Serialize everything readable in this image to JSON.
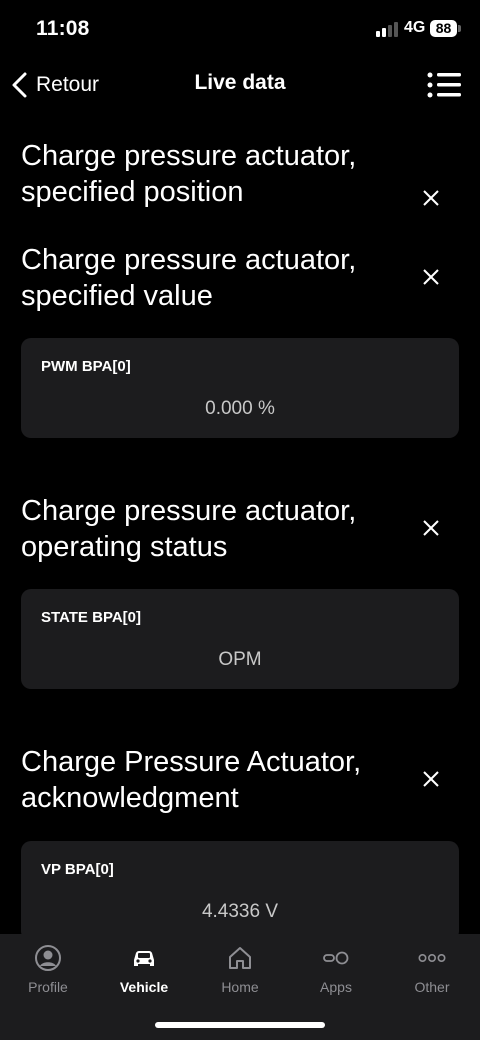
{
  "status_bar": {
    "time": "11:08",
    "network": "4G",
    "battery": "88"
  },
  "nav": {
    "back_label": "Retour",
    "title": "Live data",
    "menu_icon": "list-menu-icon"
  },
  "sections": [
    {
      "title": "Charge pressure actuator, specified position"
    },
    {
      "title": "Charge pressure actuator, specified value",
      "card": {
        "label": "PWM BPA[0]",
        "value": "0.000 %"
      }
    },
    {
      "title": "Charge pressure actuator, operating status",
      "card": {
        "label": "STATE BPA[0]",
        "value": "OPM"
      }
    },
    {
      "title": "Charge Pressure Actuator, acknowledgment",
      "card": {
        "label": "VP BPA[0]",
        "value": "4.4336 V"
      }
    }
  ],
  "tabs": [
    {
      "label": "Profile",
      "icon": "profile-icon",
      "active": false
    },
    {
      "label": "Vehicle",
      "icon": "car-icon",
      "active": true
    },
    {
      "label": "Home",
      "icon": "home-icon",
      "active": false
    },
    {
      "label": "Apps",
      "icon": "apps-icon",
      "active": false
    },
    {
      "label": "Other",
      "icon": "more-icon",
      "active": false
    }
  ]
}
